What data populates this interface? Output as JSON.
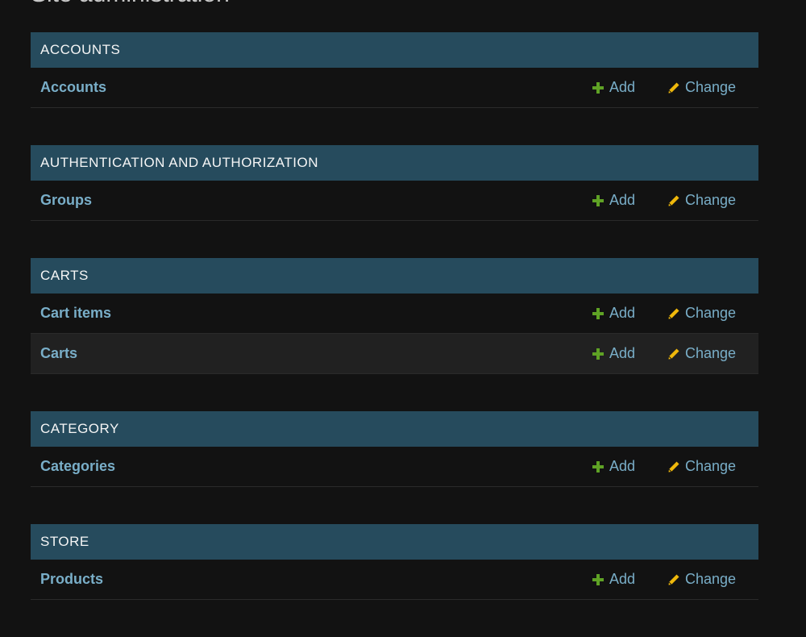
{
  "page": {
    "title": "Site administration"
  },
  "colors": {
    "header_bg": "#264b5d",
    "link": "#79aec8",
    "add_icon": "#5fa225",
    "change_icon": "#efb80b",
    "background": "#121212"
  },
  "modules": [
    {
      "name": "ACCOUNTS",
      "models": [
        {
          "label": "Accounts",
          "add": "Add",
          "change": "Change"
        }
      ]
    },
    {
      "name": "AUTHENTICATION AND AUTHORIZATION",
      "models": [
        {
          "label": "Groups",
          "add": "Add",
          "change": "Change"
        }
      ]
    },
    {
      "name": "CARTS",
      "models": [
        {
          "label": "Cart items",
          "add": "Add",
          "change": "Change"
        },
        {
          "label": "Carts",
          "add": "Add",
          "change": "Change"
        }
      ]
    },
    {
      "name": "CATEGORY",
      "models": [
        {
          "label": "Categories",
          "add": "Add",
          "change": "Change"
        }
      ]
    },
    {
      "name": "STORE",
      "models": [
        {
          "label": "Products",
          "add": "Add",
          "change": "Change"
        }
      ]
    }
  ],
  "icons": {
    "add": "plus-icon",
    "change": "pencil-icon"
  }
}
